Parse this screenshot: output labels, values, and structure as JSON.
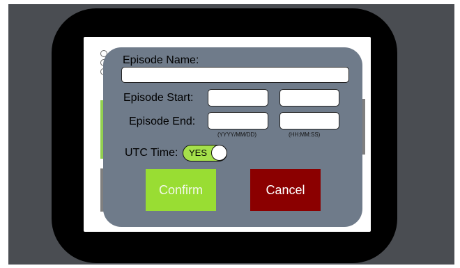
{
  "dialog": {
    "episode_name_label": "Episode Name:",
    "episode_name_value": "",
    "episode_start_label": "Episode Start:",
    "episode_start_date": "",
    "episode_start_time": "",
    "episode_end_label": "Episode End:",
    "episode_end_date": "",
    "episode_end_time": "",
    "date_hint": "(YYYY/MM/DD)",
    "time_hint": "(HH:MM:SS)",
    "utc_label": "UTC Time:",
    "utc_toggle_text": "YES",
    "utc_enabled": true,
    "confirm_label": "Confirm",
    "cancel_label": "Cancel"
  },
  "colors": {
    "dialog_bg": "#6f7b8a",
    "confirm": "#99dd33",
    "cancel": "#8b0000",
    "toggle_on": "#a5e04b",
    "device_frame": "#000000",
    "backdrop": "#4a4d52"
  }
}
